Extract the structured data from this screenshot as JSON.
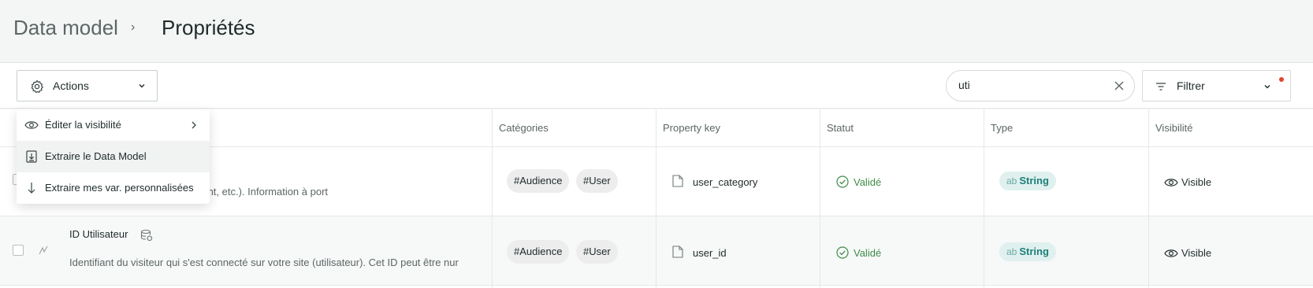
{
  "breadcrumb": {
    "parent": "Data model",
    "separator": "›",
    "current": "Propriétés"
  },
  "toolbar": {
    "actions_label": "Actions",
    "search_value": "uti",
    "filter_label": "Filtrer"
  },
  "actions_menu": {
    "items": [
      {
        "label": "Éditer la visibilité",
        "icon": "eye-icon",
        "has_submenu": true
      },
      {
        "label": "Extraire le Data Model",
        "icon": "download-file-icon",
        "highlighted": true
      },
      {
        "label": "Extraire mes var. personnalisées",
        "icon": "arrow-down-icon"
      }
    ]
  },
  "table": {
    "columns": [
      "Catégories",
      "Property key",
      "Statut",
      "Type",
      "Visibilité"
    ],
    "rows": [
      {
        "name": "",
        "description": "rs identifiés) (ex: prospect, client, etc.). Information à port",
        "categories": [
          "#Audience",
          "#User"
        ],
        "key": "user_category",
        "status": "Validé",
        "type_prefix": "ab",
        "type": "String",
        "visibility": "Visible"
      },
      {
        "name": "ID Utilisateur",
        "description": "Identifiant du visiteur qui s'est connecté sur votre site (utilisateur). Cet ID peut être nur",
        "categories": [
          "#Audience",
          "#User"
        ],
        "key": "user_id",
        "status": "Validé",
        "type_prefix": "ab",
        "type": "String",
        "visibility": "Visible"
      }
    ]
  },
  "colors": {
    "status_green": "#3f8c4a",
    "type_teal": "#1c7f79",
    "filter_dot": "#e0452b"
  }
}
